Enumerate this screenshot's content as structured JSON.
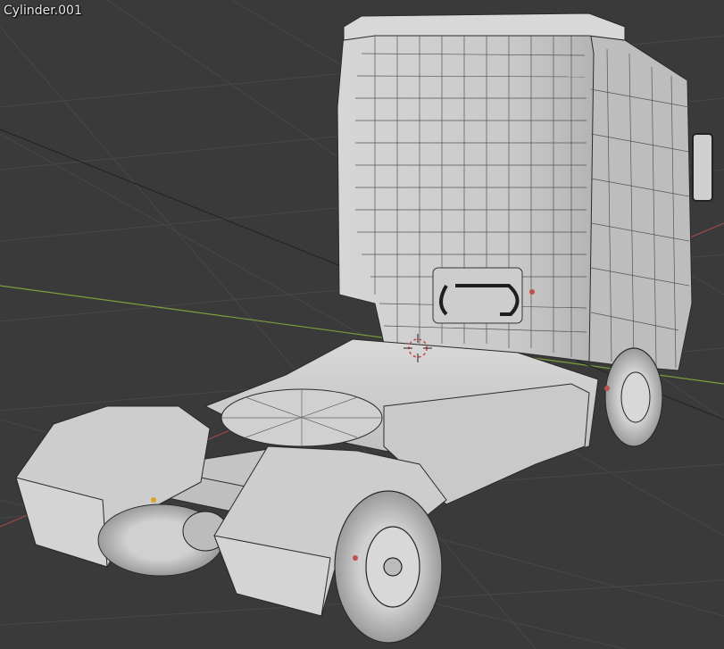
{
  "viewport": {
    "object_name": "Cylinder.001",
    "background_color": "#3a3a3a",
    "grid_color": "#484848",
    "x_axis_color": "#9b4a4a",
    "y_axis_color": "#7aa03c",
    "mesh_face_color": "#cfcfcf",
    "mesh_wire_color": "#2a2a2a",
    "cursor_color": "#d04040"
  }
}
